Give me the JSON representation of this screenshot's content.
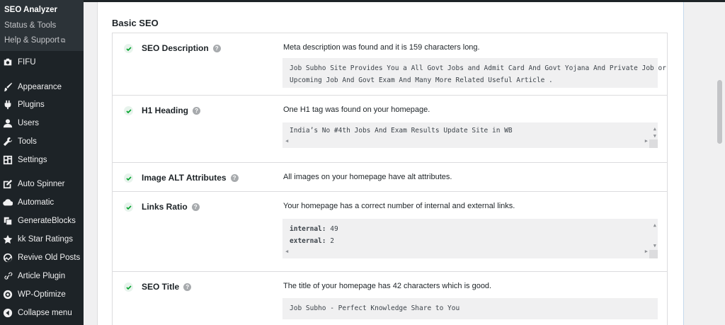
{
  "sidebar": {
    "submenu": [
      {
        "label": "SEO Analyzer",
        "current": true
      },
      {
        "label": "Status & Tools"
      },
      {
        "label": "Help & Support",
        "external": "⧉"
      }
    ],
    "items": [
      {
        "label": "FIFU",
        "icon": "camera-icon"
      },
      {
        "label": "Appearance",
        "icon": "brush-icon"
      },
      {
        "label": "Plugins",
        "icon": "plugin-icon"
      },
      {
        "label": "Users",
        "icon": "users-icon"
      },
      {
        "label": "Tools",
        "icon": "wrench-icon"
      },
      {
        "label": "Settings",
        "icon": "settings-icon"
      },
      {
        "label": "Auto Spinner",
        "icon": "edit-icon"
      },
      {
        "label": "Automatic",
        "icon": "cloud-icon"
      },
      {
        "label": "GenerateBlocks",
        "icon": "blocks-icon"
      },
      {
        "label": "kk Star Ratings",
        "icon": "star-icon"
      },
      {
        "label": "Revive Old Posts",
        "icon": "revive-icon"
      },
      {
        "label": "Article Plugin",
        "icon": "link-icon"
      },
      {
        "label": "WP-Optimize",
        "icon": "optimize-icon"
      },
      {
        "label": "Collapse menu",
        "icon": "collapse-icon"
      }
    ]
  },
  "main": {
    "section_title": "Basic SEO",
    "rows": [
      {
        "label": "SEO Description",
        "description": "Meta description was found and it is 159 characters long.",
        "code": [
          "Job Subho Site Provides You a All Govt Jobs and Admit Card And Govt Yojana And Private Job or",
          "Upcoming Job And Govt Exam And Many More Related Useful Article ."
        ]
      },
      {
        "label": "H1 Heading",
        "description": "One H1 tag was found on your homepage.",
        "code": [
          "India’s No #4th Jobs And Exam Results Update Site in WB"
        ]
      },
      {
        "label": "Image ALT Attributes",
        "description": "All images on your homepage have alt attributes."
      },
      {
        "label": "Links Ratio",
        "description": "Your homepage has a correct number of internal and external links.",
        "code_kv": [
          {
            "key": "internal:",
            "value": "49"
          },
          {
            "key": "external:",
            "value": "2"
          }
        ]
      },
      {
        "label": "SEO Title",
        "description": "The title of your homepage has 42 characters which is good.",
        "code": [
          "Job Subho - Perfect Knowledge Share to You"
        ]
      }
    ]
  },
  "colors": {
    "check": "#00a32a",
    "sidebar_bg": "#1d2327",
    "submenu_bg": "#2c3338"
  }
}
